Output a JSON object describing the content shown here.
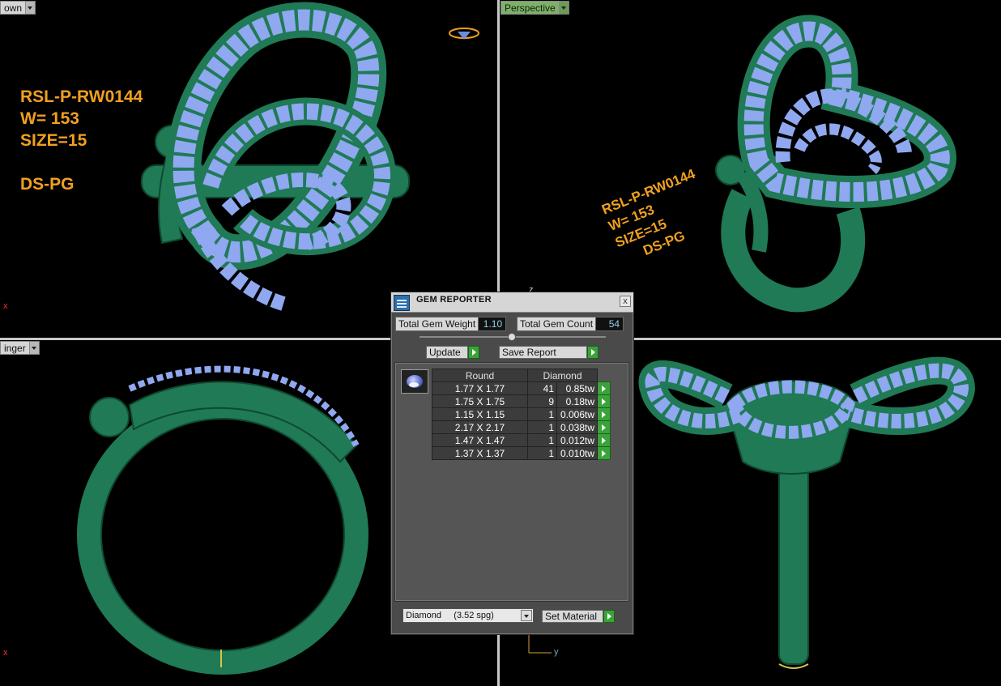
{
  "viewports": {
    "top_left": {
      "tab_label": "own"
    },
    "top_right": {
      "tab_label": "Perspective"
    },
    "bottom_left": {
      "tab_label": "inger"
    },
    "bottom_right": {
      "tab_label": ""
    }
  },
  "annotations": {
    "top_left": "RSL-P-RW0144\nW= 153\nSIZE=15\n\nDS-PG",
    "top_right": "RSL-P-RW0144\nW= 153\nSIZE=15\n      DS-PG"
  },
  "axis_labels": {
    "tl_x": "x",
    "tr_z": "z",
    "bl_x": "x",
    "br_y": "y"
  },
  "gem_reporter": {
    "title": "GEM REPORTER",
    "close_glyph": "x",
    "total_weight_label": "Total Gem Weight",
    "total_weight_value": "1.10",
    "total_count_label": "Total Gem Count",
    "total_count_value": "54",
    "update_label": "Update",
    "save_report_label": "Save Report",
    "table": {
      "header_shape": "Round",
      "header_material": "Diamond",
      "rows": [
        {
          "size": "1.77 X 1.77",
          "count": "41",
          "weight": "0.85tw"
        },
        {
          "size": "1.75 X 1.75",
          "count": "9",
          "weight": "0.18tw"
        },
        {
          "size": "1.15 X 1.15",
          "count": "1",
          "weight": "0.006tw"
        },
        {
          "size": "2.17 X 2.17",
          "count": "1",
          "weight": "0.038tw"
        },
        {
          "size": "1.47 X 1.47",
          "count": "1",
          "weight": "0.012tw"
        },
        {
          "size": "1.37 X 1.37",
          "count": "1",
          "weight": "0.010tw"
        }
      ]
    },
    "material_select": "Diamond     (3.52 spg)",
    "set_material_label": "Set Material"
  },
  "colors": {
    "metal": "#1f7a55",
    "metal_light": "#3aa37a",
    "gem": "#8fa8f0",
    "annotation": "#f0a020",
    "viewport_active_tab": "#7fb06a"
  }
}
